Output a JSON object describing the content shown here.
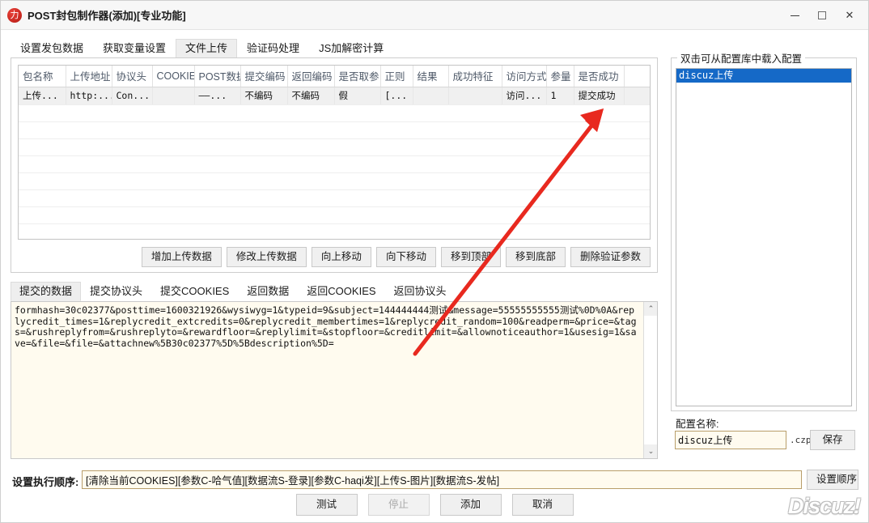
{
  "window": {
    "title": "POST封包制作器(添加)[专业功能]",
    "icon": "app-logo-icon",
    "minimize": "−",
    "maximize": "□",
    "close": "✕"
  },
  "top_tabs": [
    {
      "label": "设置发包数据",
      "active": false
    },
    {
      "label": "获取变量设置",
      "active": false
    },
    {
      "label": "文件上传",
      "active": true
    },
    {
      "label": "验证码处理",
      "active": false
    },
    {
      "label": "JS加解密计算",
      "active": false
    }
  ],
  "grid": {
    "columns": [
      "包名称",
      "上传地址",
      "协议头",
      "COOKIE",
      "POST数据",
      "提交编码",
      "返回编码",
      "是否取参",
      "正则",
      "结果",
      "成功特征",
      "访问方式",
      "参量",
      "是否成功"
    ],
    "rows": [
      [
        "上传...",
        "http:...",
        "Con...",
        "",
        "——...",
        "不编码",
        "不编码",
        "假",
        "[...",
        "",
        "",
        "访问...",
        "1",
        "提交成功"
      ]
    ],
    "empty_row_count": 8
  },
  "grid_buttons": [
    "增加上传数据",
    "修改上传数据",
    "向上移动",
    "向下移动",
    "移到顶部",
    "移到底部",
    "删除验证参数"
  ],
  "bottom_tabs": [
    {
      "label": "提交的数据",
      "active": true
    },
    {
      "label": "提交协议头",
      "active": false
    },
    {
      "label": "提交COOKIES",
      "active": false
    },
    {
      "label": "返回数据",
      "active": false
    },
    {
      "label": "返回COOKIES",
      "active": false
    },
    {
      "label": "返回协议头",
      "active": false
    }
  ],
  "data_area": {
    "content": "formhash=30c02377&posttime=1600321926&wysiwyg=1&typeid=9&subject=144444444测试&message=55555555555测试%0D%0A&replycredit_times=1&replycredit_extcredits=0&replycredit_membertimes=1&replycredit_random=100&readperm=&price=&tags=&rushreplyfrom=&rushreplyto=&rewardfloor=&replylimit=&stopfloor=&creditlimit=&allownoticeauthor=1&usesig=1&save=&file=&file=&attachnew%5B30c02377%5D%5Bdescription%5D=",
    "scroll_up": "⌃",
    "scroll_down": "⌄"
  },
  "config_panel": {
    "legend": "双击可从配置库中载入配置",
    "items": [
      {
        "label": "discuz上传",
        "selected": true
      }
    ],
    "name_label": "配置名称:",
    "name_value": "discuz上传",
    "extension": ".czp",
    "save_label": "保存"
  },
  "exec_order": {
    "label": "设置执行顺序:",
    "value": "[清除当前COOKIES][参数C-哈气值][数据流S-登录][参数C-haqi发][上传S-图片][数据流S-发帖]",
    "button": "设置顺序"
  },
  "actions": [
    {
      "label": "测试",
      "disabled": false
    },
    {
      "label": "停止",
      "disabled": true
    },
    {
      "label": "添加",
      "disabled": false
    },
    {
      "label": "取消",
      "disabled": false
    }
  ],
  "watermark": "Discuz!",
  "annotation": {
    "type": "arrow",
    "color": "#e8291f",
    "points": "from (510,435) to (745,135)"
  }
}
